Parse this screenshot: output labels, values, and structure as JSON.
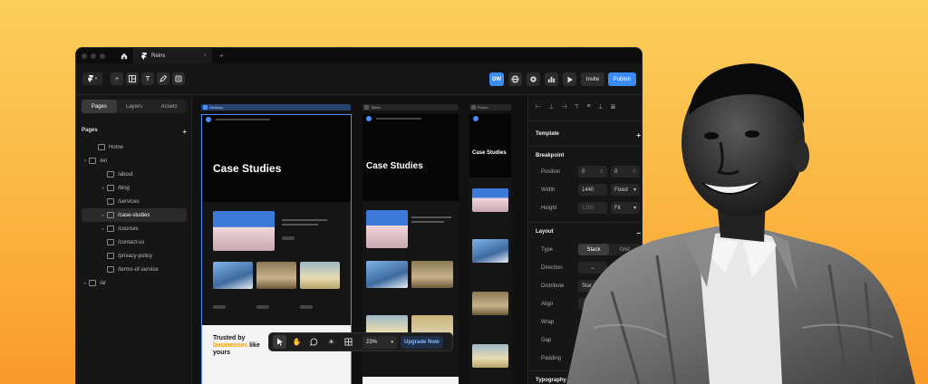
{
  "tabs": {
    "home_icon": "home-icon",
    "document_tab": "Reins",
    "close": "×",
    "new_tab": "+"
  },
  "toolbar": {
    "logo_icon": "framer-logo",
    "tools": [
      "plus-icon",
      "layout-icon",
      "text-icon",
      "pen-icon",
      "component-icon"
    ],
    "avatar": "DW",
    "invite": "Invite",
    "publish": "Publish",
    "accent": "#3b8bf5"
  },
  "left_panel": {
    "tabs": [
      "Pages",
      "Layers",
      "Assets"
    ],
    "active_tab": "Pages",
    "pages_heading": "Pages",
    "add": "+",
    "pages": [
      {
        "label": "Home",
        "level": 1,
        "caret": "",
        "selected": false
      },
      {
        "label": "/en",
        "level": 0,
        "caret": "▾",
        "selected": false
      },
      {
        "label": "/about",
        "level": 2,
        "caret": "",
        "selected": false
      },
      {
        "label": "/blog",
        "level": 2,
        "caret": "▸",
        "selected": false
      },
      {
        "label": "/services",
        "level": 2,
        "caret": "",
        "selected": false
      },
      {
        "label": "/case-studies",
        "level": 2,
        "caret": "▸",
        "selected": true
      },
      {
        "label": "/courses",
        "level": 2,
        "caret": "▸",
        "selected": false
      },
      {
        "label": "/contact-us",
        "level": 2,
        "caret": "",
        "selected": false
      },
      {
        "label": "/privacy-policy",
        "level": 2,
        "caret": "",
        "selected": false
      },
      {
        "label": "/terms-of-service",
        "level": 2,
        "caret": "",
        "selected": false
      },
      {
        "label": "/ar",
        "level": 0,
        "caret": "▸",
        "selected": false
      }
    ]
  },
  "canvas": {
    "frames": [
      {
        "label": "Desktop",
        "heading": "Case Studies"
      },
      {
        "label": "Tablet",
        "heading": "Case Studies"
      },
      {
        "label": "Phone",
        "heading": "Case Studies"
      }
    ],
    "trusted_prefix": "Trusted by",
    "trusted_highlight": "businesses",
    "trusted_suffix_1": "like",
    "trusted_suffix_2": "yours",
    "highlight_color": "#e8a21c"
  },
  "floating_bar": {
    "tools": [
      "pointer-icon",
      "hand-icon",
      "comment-icon",
      "sun-icon",
      "grid-icon"
    ],
    "zoom": "23%",
    "upgrade": "Upgrade Now"
  },
  "right_panel": {
    "template": "Template",
    "breakpoint": "Breakpoint",
    "position_label": "Position",
    "position_x": "0",
    "position_y": "0",
    "width_label": "Width",
    "width_value": "1440",
    "width_mode": "Fixed",
    "height_label": "Height",
    "height_value": "1299",
    "height_mode": "Fit",
    "layout": "Layout",
    "type_label": "Type",
    "type_options": [
      "Stack",
      "Grid"
    ],
    "direction_label": "Direction",
    "distribute_label": "Distribute",
    "distribute_value": "Star",
    "align_label": "Align",
    "wrap_label": "Wrap",
    "gap_label": "Gap",
    "padding_label": "Padding",
    "typography": "Typography"
  }
}
